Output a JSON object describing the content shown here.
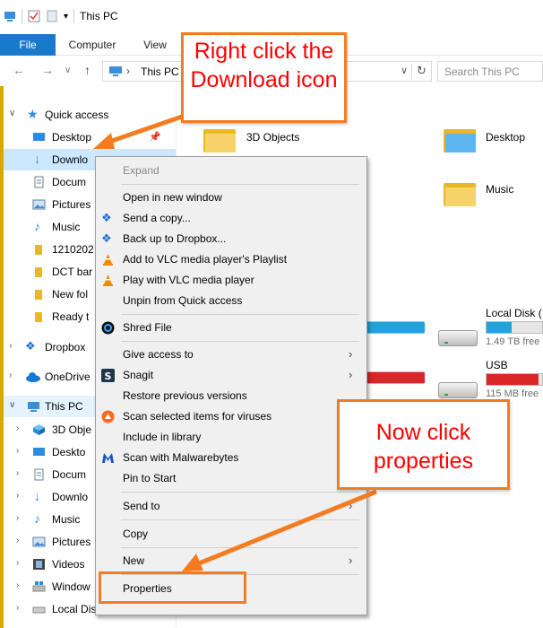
{
  "window": {
    "title": "This PC"
  },
  "ribbon": {
    "tabs": [
      "File",
      "Computer",
      "View"
    ]
  },
  "address": {
    "path": "This PC",
    "search_placeholder": "Search This PC"
  },
  "nav": {
    "quick_access": "Quick access",
    "items": [
      {
        "label": "Desktop",
        "icon": "desktop-icon"
      },
      {
        "label": "Downlo",
        "icon": "download-icon"
      },
      {
        "label": "Docum",
        "icon": "documents-icon"
      },
      {
        "label": "Pictures",
        "icon": "pictures-icon"
      },
      {
        "label": "Music",
        "icon": "music-icon"
      },
      {
        "label": "1210202",
        "icon": "folder-icon"
      },
      {
        "label": "DCT bar",
        "icon": "folder-icon"
      },
      {
        "label": "New fol",
        "icon": "folder-icon"
      },
      {
        "label": "Ready t",
        "icon": "folder-icon"
      }
    ],
    "dropbox": "Dropbox",
    "onedrive": "OneDrive",
    "this_pc": "This PC",
    "pc_items": [
      {
        "label": "3D Obje",
        "icon": "3d-objects-icon"
      },
      {
        "label": "Deskto",
        "icon": "desktop-icon"
      },
      {
        "label": "Docum",
        "icon": "documents-icon"
      },
      {
        "label": "Downlo",
        "icon": "download-icon"
      },
      {
        "label": "Music",
        "icon": "music-icon"
      },
      {
        "label": "Pictures",
        "icon": "pictures-icon"
      },
      {
        "label": "Videos",
        "icon": "videos-icon"
      },
      {
        "label": "Window",
        "icon": "windows-drive-icon"
      },
      {
        "label": "Local Disk (D:)",
        "icon": "drive-icon"
      }
    ]
  },
  "content": {
    "folders": [
      "3D Objects",
      "Desktop",
      "Music"
    ],
    "drives": [
      {
        "name": "Local Disk (",
        "free": "1.49 TB free",
        "used_fraction": 0.45,
        "color": "#26a0da"
      },
      {
        "name": "USB DRIVE (",
        "free": "115 MB free",
        "used_fraction": 0.93,
        "color": "#da2626"
      }
    ]
  },
  "context_menu": {
    "expand": "Expand",
    "group1": [
      "Open in new window",
      "Send a copy...",
      "Back up to Dropbox...",
      "Add to VLC media player's Playlist",
      "Play with VLC media player",
      "Unpin from Quick access"
    ],
    "shred": "Shred File",
    "group2": [
      "Give access to",
      "Snagit",
      "Restore previous versions",
      "Scan selected items for viruses",
      "Include in library",
      "Scan with Malwarebytes",
      "Pin to Start"
    ],
    "send_to": "Send to",
    "copy": "Copy",
    "new": "New",
    "properties": "Properties"
  },
  "annotations": {
    "callout1": "Right click the Download icon",
    "callout2": "Now click properties",
    "accent_color": "#f47c20",
    "text_color": "#ff0000"
  }
}
